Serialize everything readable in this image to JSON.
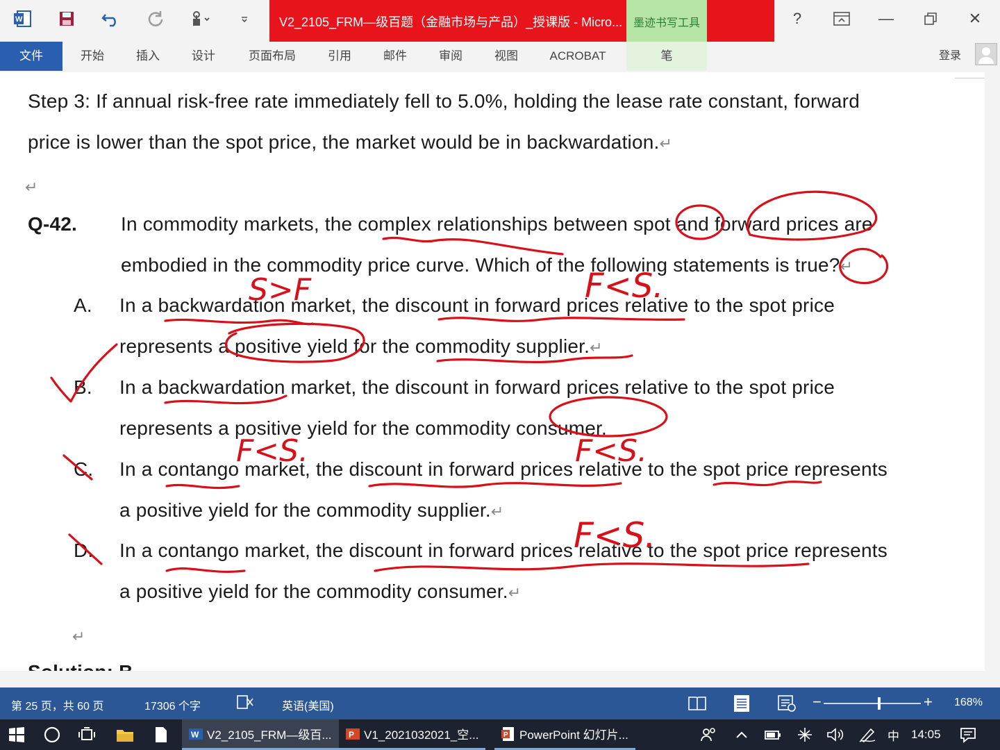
{
  "window": {
    "title": "V2_2105_FRM—级百题（金融市场与产品）_授课版 - Micro...",
    "ink_tools_tab": "墨迹书写工具",
    "help": "?",
    "minimize": "—",
    "close": "✕"
  },
  "ribbon": {
    "tabs": [
      "文件",
      "开始",
      "插入",
      "设计",
      "页面布局",
      "引用",
      "邮件",
      "审阅",
      "视图",
      "ACROBAT",
      "笔"
    ],
    "login": "登录"
  },
  "document": {
    "step3_line1": "Step 3: If annual risk-free rate immediately fell to 5.0%, holding the lease rate constant, forward",
    "step3_line2": "price is lower than the spot price, the market would be in backwardation.",
    "para_mark": "↵",
    "question_label": "Q-42.",
    "question_line1": "In commodity markets, the complex relationships between spot and forward prices are",
    "question_line2": "embodied in the commodity price curve. Which of the following statements is true?",
    "options": [
      {
        "letter": "A.",
        "line1": "In a backwardation market, the discount in forward prices relative to the spot price",
        "line2": "represents a positive yield for the commodity supplier."
      },
      {
        "letter": "B.",
        "line1": "In a backwardation market, the discount in forward prices relative to the spot price",
        "line2": "represents a positive yield for the commodity consumer."
      },
      {
        "letter": "C.",
        "line1": "In a contango market, the discount in forward prices relative to the spot price represents",
        "line2": "a positive yield for the commodity supplier."
      },
      {
        "letter": "D.",
        "line1": "In a contango market, the discount in forward prices relative to the spot price represents",
        "line2": "a positive yield for the commodity consumer."
      }
    ],
    "solution_partial": "Solution: B"
  },
  "annotations": {
    "s_gt_f": "S>F",
    "f_lt_s": "F<S.",
    "ink_color": "#d8101a"
  },
  "statusbar": {
    "page": "第 25 页，共 60 页",
    "words": "17306 个字",
    "language": "英语(美国)",
    "zoom": "168%",
    "zoom_level": 0.57
  },
  "taskbar": {
    "apps": [
      {
        "label": "V2_2105_FRM—级百..."
      },
      {
        "label": "V1_2021032021_空..."
      },
      {
        "label": "PowerPoint 幻灯片..."
      }
    ],
    "ime": "中",
    "time": "14:05"
  }
}
